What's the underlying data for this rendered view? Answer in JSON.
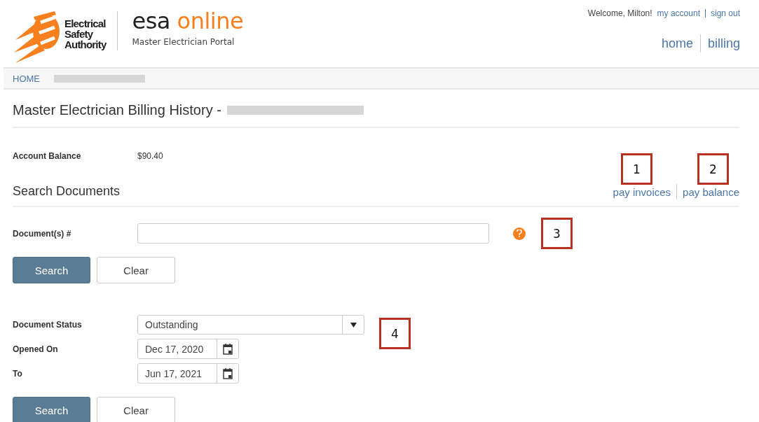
{
  "header": {
    "logo_lines": [
      "Electrical",
      "Safety",
      "Authority"
    ],
    "brand": "esa",
    "brand_accent": "online",
    "subtitle": "Master Electrician Portal",
    "welcome": "Welcome, Milton!",
    "account_links": [
      "my account",
      "sign out"
    ],
    "nav": [
      "home",
      "billing"
    ]
  },
  "breadcrumb": [
    "HOME"
  ],
  "title": "Master Electrician Billing History -",
  "account": {
    "label": "Account Balance",
    "value": "$90.40"
  },
  "section": {
    "title": "Search Documents",
    "links": [
      "pay invoices",
      "pay balance"
    ]
  },
  "document_search": {
    "label": "Document(s) #",
    "buttons": [
      {
        "label": "Search",
        "kind": "primary"
      },
      {
        "label": "Clear",
        "kind": "secondary"
      }
    ]
  },
  "filters": {
    "status": {
      "label": "Document Status",
      "value": "Outstanding"
    },
    "dates": [
      {
        "label": "Opened On",
        "value": "Dec 17, 2020"
      },
      {
        "label": "To",
        "value": "Jun 17, 2021"
      }
    ],
    "buttons": [
      {
        "label": "Search",
        "kind": "primary"
      },
      {
        "label": "Clear",
        "kind": "secondary"
      }
    ]
  },
  "callouts": [
    "1",
    "2",
    "3",
    "4"
  ]
}
